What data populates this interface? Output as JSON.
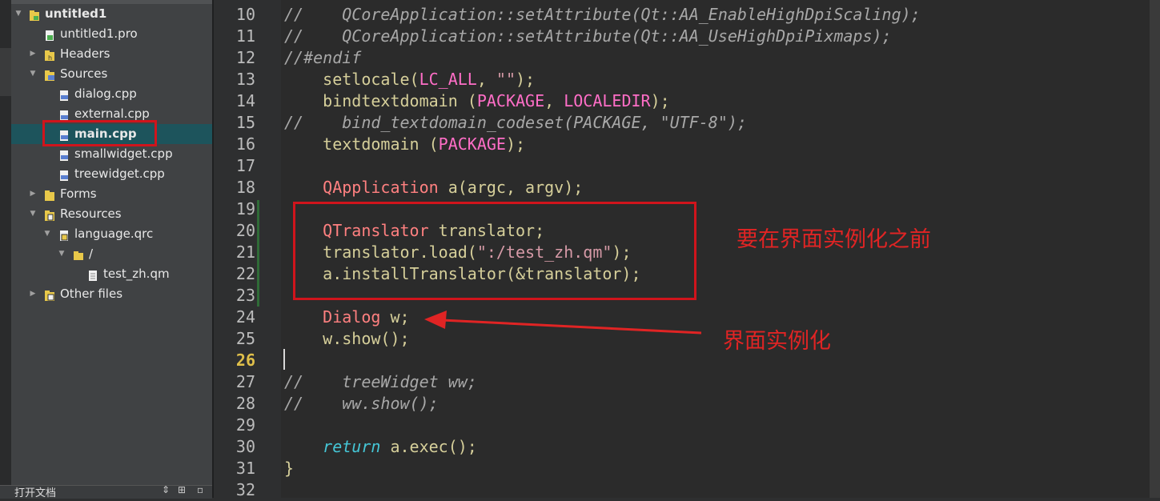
{
  "project_tree": {
    "root": {
      "label": "untitled1",
      "icon": "project-icon"
    },
    "items": [
      {
        "label": "untitled1.pro",
        "icon": "pro-file-icon"
      },
      {
        "label": "Headers",
        "icon": "headers-folder-icon"
      },
      {
        "label": "Sources",
        "icon": "sources-folder-icon"
      },
      {
        "label": "dialog.cpp",
        "icon": "cpp-file-icon"
      },
      {
        "label": "external.cpp",
        "icon": "cpp-file-icon"
      },
      {
        "label": "main.cpp",
        "icon": "cpp-file-icon",
        "selected": true
      },
      {
        "label": "smallwidget.cpp",
        "icon": "cpp-file-icon"
      },
      {
        "label": "treewidget.cpp",
        "icon": "cpp-file-icon"
      },
      {
        "label": "Forms",
        "icon": "forms-folder-icon"
      },
      {
        "label": "Resources",
        "icon": "resources-folder-icon"
      },
      {
        "label": "language.qrc",
        "icon": "qrc-file-icon"
      },
      {
        "label": "/",
        "icon": "folder-icon"
      },
      {
        "label": "test_zh.qm",
        "icon": "file-icon"
      },
      {
        "label": "Other files",
        "icon": "other-files-folder-icon"
      }
    ]
  },
  "open_docs_bar": {
    "label": "打开文档",
    "sort_icon": "sort-arrows-icon",
    "split_icon": "split-icon",
    "close_icon": "close-icon"
  },
  "editor": {
    "line_numbers": [
      "10",
      "11",
      "12",
      "13",
      "14",
      "15",
      "16",
      "17",
      "18",
      "19",
      "20",
      "21",
      "22",
      "23",
      "24",
      "25",
      "26",
      "27",
      "28",
      "29",
      "30",
      "31",
      "32"
    ],
    "current_line": "26",
    "code": {
      "l10": "//    QCoreApplication::setAttribute(Qt::AA_EnableHighDpiScaling);",
      "l11": "//    QCoreApplication::setAttribute(Qt::AA_UseHighDpiPixmaps);",
      "l12": "//#endif",
      "l13_a": "    setlocale(",
      "l13_b": "LC_ALL",
      "l13_c": ", ",
      "l13_d": "\"\"",
      "l13_e": ");",
      "l14_a": "    bindtextdomain (",
      "l14_b": "PACKAGE",
      "l14_c": ", ",
      "l14_d": "LOCALEDIR",
      "l14_e": ");",
      "l15": "//    bind_textdomain_codeset(PACKAGE, \"UTF-8\");",
      "l16_a": "    textdomain (",
      "l16_b": "PACKAGE",
      "l16_c": ");",
      "l18_a": "    ",
      "l18_b": "QApplication",
      "l18_c": " a(argc, argv);",
      "l20_a": "    ",
      "l20_b": "QTranslator",
      "l20_c": " translator;",
      "l21_a": "    translator.load(",
      "l21_b": "\":/test_zh.qm\"",
      "l21_c": ");",
      "l22": "    a.installTranslator(&translator);",
      "l24_a": "    ",
      "l24_b": "Dialog",
      "l24_c": " w;",
      "l25": "    w.show();",
      "l27": "//    treeWidget ww;",
      "l28": "//    ww.show();",
      "l30_a": "    ",
      "l30_b": "return",
      "l30_c": " a.exec();",
      "l31": "}"
    }
  },
  "annotations": {
    "box_note": "要在界面实例化之前",
    "arrow_note": "界面实例化"
  },
  "colors": {
    "annotation_red": "#e02424",
    "selection": "#1d545c",
    "current_line_number": "#e0c04a"
  }
}
